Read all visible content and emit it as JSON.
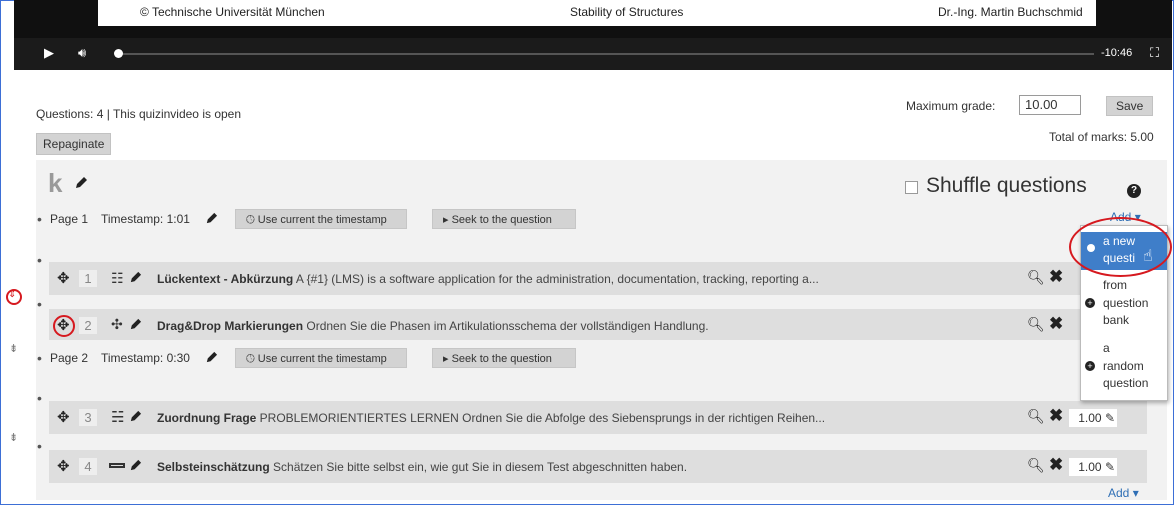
{
  "video": {
    "footer_left": "© Technische Universität München",
    "footer_center": "Stability of Structures",
    "footer_right": "Dr.-Ing. Martin Buchschmid",
    "time_remaining": "-10:46",
    "progress": 0.0
  },
  "header": {
    "status": "Questions: 4 | This quizinvideo is open",
    "repaginate_label": "Repaginate",
    "max_grade_label": "Maximum grade:",
    "max_grade_value": "10.00",
    "save_label": "Save",
    "total_marks": "Total of marks: 5.00"
  },
  "section": {
    "heading": "k",
    "shuffle_label": "Shuffle questions",
    "add_label": "Add"
  },
  "pages": [
    {
      "label": "Page 1",
      "timestamp": "Timestamp: 1:01",
      "use_label": "Use current the timestamp",
      "seek_label": "Seek to the question"
    },
    {
      "label": "Page 2",
      "timestamp": "Timestamp: 0:30",
      "use_label": "Use current the timestamp",
      "seek_label": "Seek to the question"
    }
  ],
  "questions": [
    {
      "num": "1",
      "name": "Lückentext - Abkürzung",
      "text": "A {#1} (LMS) is a software application for the administration, documentation, tracking, reporting a...",
      "mark": ""
    },
    {
      "num": "2",
      "name": "Drag&Drop Markierungen",
      "text": "Ordnen Sie die Phasen im Artikulationsschema der vollständigen Handlung.",
      "mark": ""
    },
    {
      "num": "3",
      "name": "Zuordnung Frage",
      "text": "PROBLEMORIENTIERTES LERNEN Ordnen Sie die Abfolge des Siebensprungs in der richtigen Reihen...",
      "mark": "1.00"
    },
    {
      "num": "4",
      "name": "Selbsteinschätzung",
      "text": "Schätzen Sie bitte selbst ein, wie gut Sie in diesem Test abgeschnitten haben.",
      "mark": "1.00"
    }
  ],
  "add_menu": {
    "items": [
      {
        "line1": "a new",
        "line2": "questi"
      },
      {
        "line1": "from",
        "line2": "question",
        "line3": "bank"
      },
      {
        "line1": "a",
        "line2": "random",
        "line3": "question"
      }
    ]
  },
  "bottom_add_label": "Add",
  "colors": {
    "accent": "#3f7ec9",
    "highlight": "#d6191f",
    "link": "#2f6fb5"
  },
  "icons": [
    "play-icon",
    "volume-icon",
    "fullscreen-icon",
    "edit-icon",
    "move-icon",
    "search-icon",
    "delete-icon",
    "help-icon",
    "add-icon",
    "page-break-icon"
  ]
}
